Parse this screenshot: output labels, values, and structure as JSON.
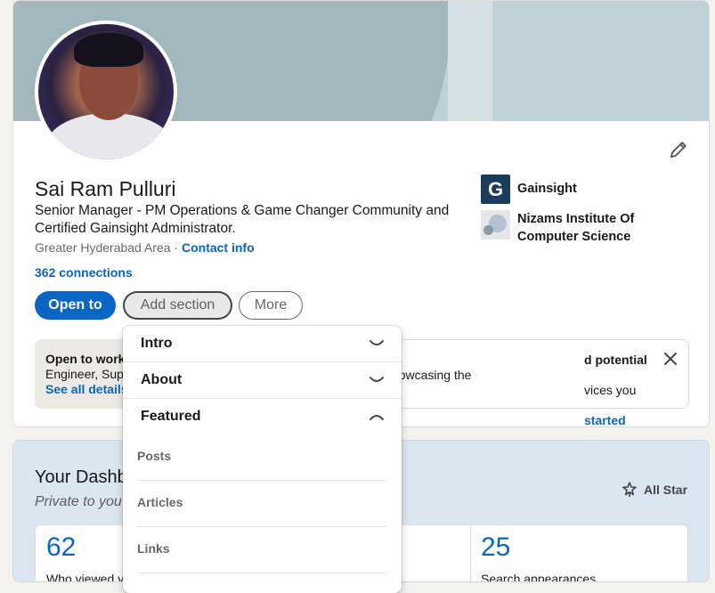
{
  "profile": {
    "name": "Sai Ram Pulluri",
    "headline": "Senior Manager - PM Operations & Game Changer Community and Certified Gainsight Administrator.",
    "location": "Greater Hyderabad Area",
    "separator": "·",
    "contact_info": "Contact info",
    "connections": "362 connections"
  },
  "experience": [
    {
      "logo_letter": "G",
      "label": "Gainsight"
    },
    {
      "label": "Nizams Institute Of Computer Science"
    }
  ],
  "actions": {
    "open_to": "Open to",
    "add_section": "Add section",
    "more": "More"
  },
  "open_to_card": {
    "bold": "Open to work",
    "text": "Engineer, Sup",
    "link": "See all details"
  },
  "clients_card": {
    "bold": "d potential clients",
    "text1": " by showcasing the",
    "text2": "vices you provide.",
    "link": "started"
  },
  "add_section_menu": {
    "sections": [
      {
        "label": "Intro",
        "expanded": false
      },
      {
        "label": "About",
        "expanded": false
      },
      {
        "label": "Featured",
        "expanded": true
      }
    ],
    "featured_items": [
      "Posts",
      "Articles",
      "Links"
    ]
  },
  "dashboard": {
    "title": "Your Dashb",
    "subtitle": "Private to you",
    "all_star": "All Star",
    "stats": [
      {
        "value": "62",
        "label": "Who viewed y"
      },
      {
        "value": "25",
        "label": "Search appearances"
      }
    ]
  },
  "colors": {
    "primary": "#0a66c2",
    "page_bg": "#f3f2ef",
    "dashboard_bg": "#dce6f1"
  }
}
